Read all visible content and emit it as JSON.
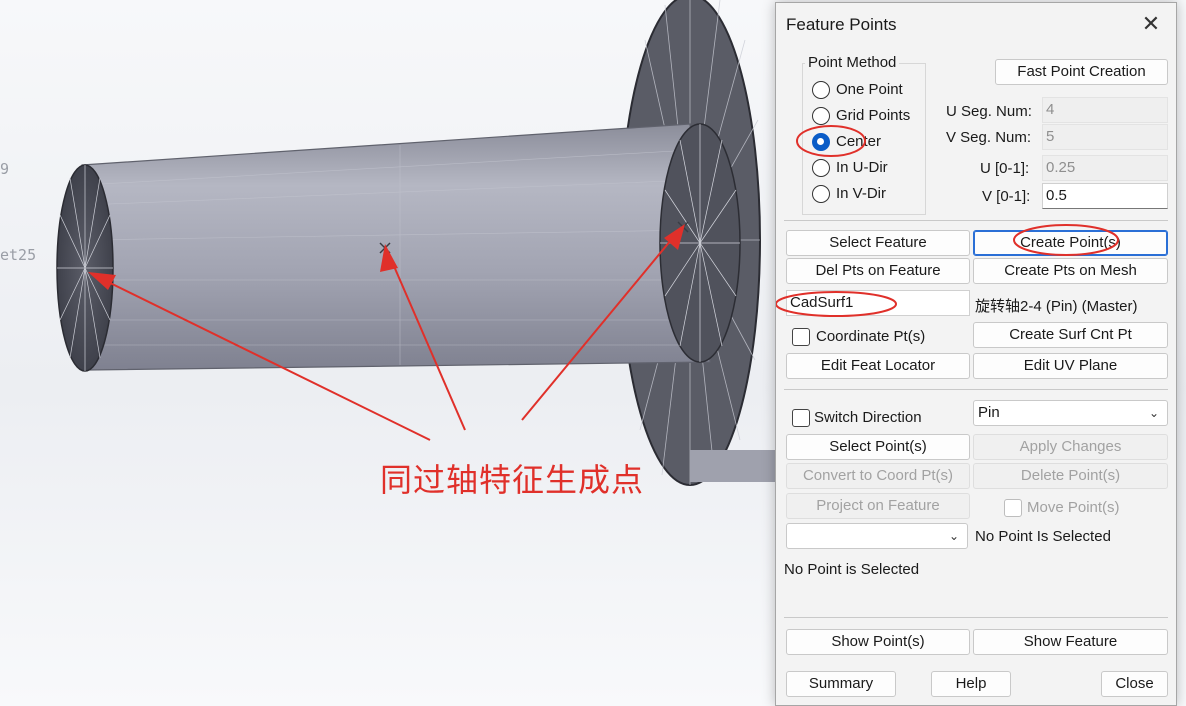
{
  "background": {
    "fragment_1": "9",
    "fragment_2": "et25",
    "caption": "同过轴特征生成点",
    "accent_red": "#e0302a"
  },
  "dialog": {
    "title": "Feature Points",
    "point_method": {
      "title": "Point Method",
      "options": [
        "One Point",
        "Grid Points",
        "Center",
        "In U-Dir",
        "In V-Dir"
      ],
      "selected": "Center"
    },
    "fast_point_creation": "Fast Point Creation",
    "u_seg_label": "U Seg. Num:",
    "u_seg_value": "4",
    "v_seg_label": "V Seg. Num:",
    "v_seg_value": "5",
    "u_label": "U [0-1]:",
    "u_value": "0.25",
    "v_label": "V [0-1]:",
    "v_value": "0.5",
    "select_feature": "Select Feature",
    "create_points": "Create Point(s)",
    "del_pts_on_feature": "Del Pts on Feature",
    "create_pts_on_mesh": "Create Pts on Mesh",
    "feature_name": "CadSurf1",
    "feature_info": "旋转轴2-4 (Pin) (Master)",
    "coordinate_pts": "Coordinate Pt(s)",
    "create_surf_cnt_pt": "Create Surf Cnt Pt",
    "edit_feat_locator": "Edit Feat Locator",
    "edit_uv_plane": "Edit UV Plane",
    "switch_direction": "Switch Direction",
    "type_value": "Pin",
    "select_points": "Select Point(s)",
    "apply_changes": "Apply Changes",
    "convert_to_coord": "Convert to Coord Pt(s)",
    "delete_points": "Delete Point(s)",
    "project_on_feature": "Project on Feature",
    "move_points": "Move Point(s)",
    "point_dropdown_value": "",
    "no_point_selected": "No Point Is Selected",
    "status": "No Point is Selected",
    "show_points": "Show Point(s)",
    "show_feature": "Show Feature",
    "summary": "Summary",
    "help": "Help",
    "close": "Close"
  }
}
